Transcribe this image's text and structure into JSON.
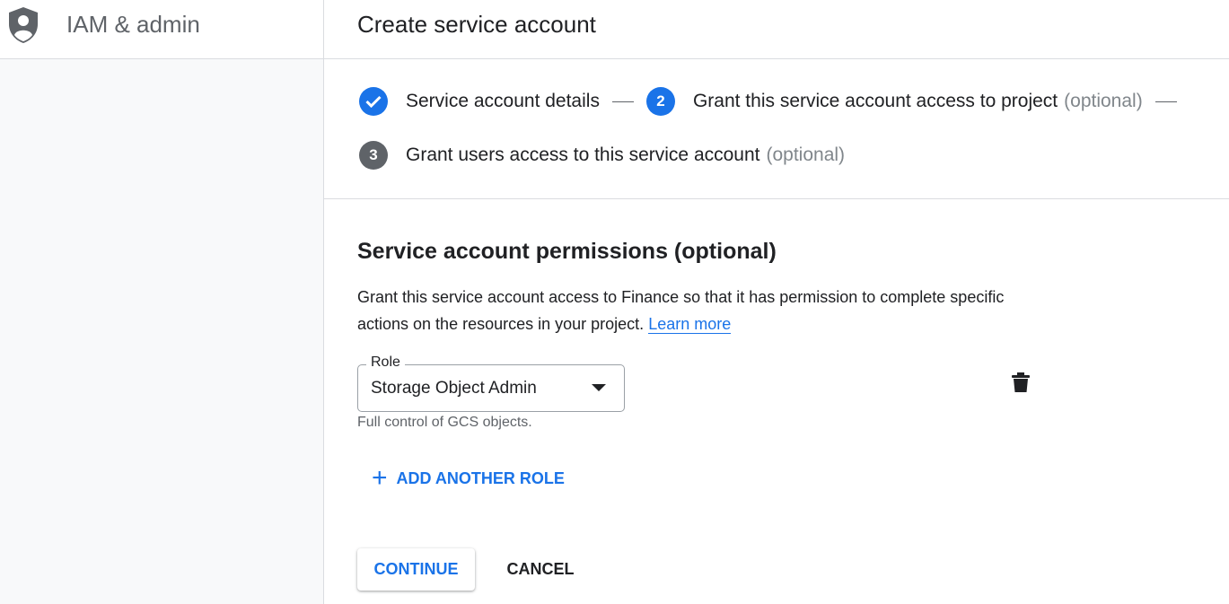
{
  "sidebar": {
    "product_icon": "shield-person-icon",
    "product_title": "IAM & admin"
  },
  "header": {
    "title": "Create service account"
  },
  "stepper": {
    "steps": [
      {
        "number": "",
        "label": "Service account details",
        "optional": "",
        "state": "done",
        "icon": "check-icon"
      },
      {
        "number": "2",
        "label": "Grant this service account access to project",
        "optional": "(optional)",
        "state": "active"
      },
      {
        "number": "3",
        "label": "Grant users access to this service account",
        "optional": "(optional)",
        "state": "pending"
      }
    ]
  },
  "permissions": {
    "title": "Service account permissions (optional)",
    "description": "Grant this service account access to Finance so that it has permission to complete specific actions on the resources in your project.",
    "learn_more": "Learn more",
    "role_label": "Role",
    "role_value": "Storage Object Admin",
    "role_hint": "Full control of GCS objects.",
    "delete_icon": "trash-icon",
    "add_role_label": "ADD ANOTHER ROLE"
  },
  "actions": {
    "continue_label": "CONTINUE",
    "cancel_label": "CANCEL"
  },
  "colors": {
    "accent": "#1a73e8",
    "pending_step": "#5f6368",
    "sidebar_bg": "#f8f9fa"
  }
}
